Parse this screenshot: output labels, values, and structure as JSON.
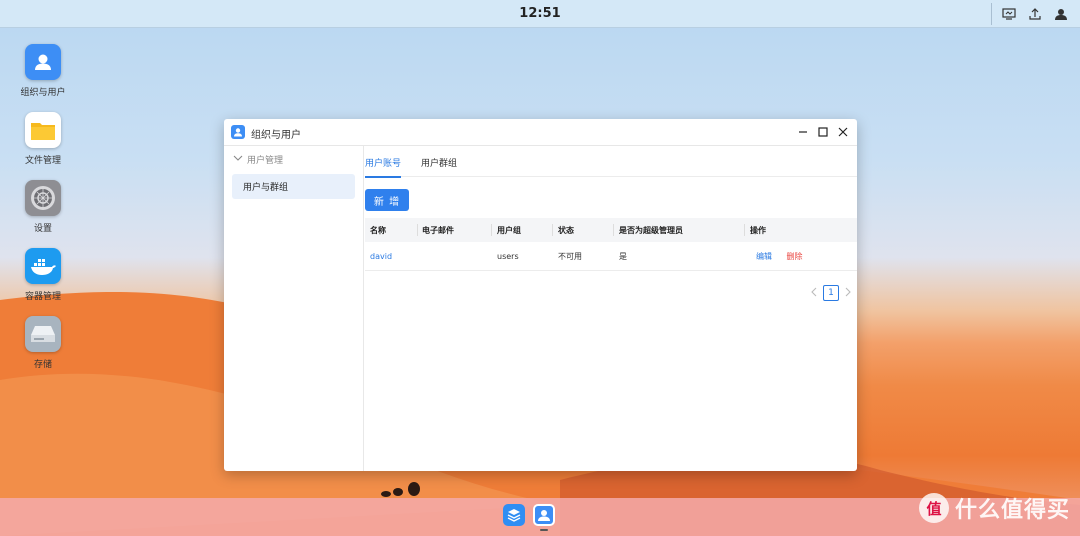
{
  "topbar": {
    "clock": "12:51",
    "tray_icons": [
      "screen-icon",
      "upload-icon",
      "user-icon"
    ]
  },
  "desktop_icons": [
    {
      "label": "组织与用户",
      "icon": "user-icon",
      "color": "#3d8ef5"
    },
    {
      "label": "文件管理",
      "icon": "folder-icon",
      "color": "#ffffff"
    },
    {
      "label": "设置",
      "icon": "settings-icon",
      "color": "#8e8e93"
    },
    {
      "label": "容器管理",
      "icon": "docker-icon",
      "color": "#1d9bf0"
    },
    {
      "label": "存储",
      "icon": "drive-icon",
      "color": "#a8b4bf"
    }
  ],
  "window": {
    "title": "组织与用户",
    "sidebar": {
      "group_label": "用户管理",
      "items": [
        {
          "label": "用户与群组"
        }
      ]
    },
    "tabs": [
      {
        "label": "用户账号"
      },
      {
        "label": "用户群组"
      }
    ],
    "add_button": "新 增",
    "table": {
      "headers": [
        "名称",
        "电子邮件",
        "用户组",
        "状态",
        "是否为超级管理员",
        "操作"
      ],
      "rows": [
        {
          "name": "david",
          "email": "",
          "group": "users",
          "status": "不可用",
          "is_admin": "是",
          "edit": "编辑",
          "delete": "删除"
        }
      ]
    },
    "pagination": {
      "current": "1"
    }
  },
  "watermark": {
    "symbol": "值",
    "text": "什么值得买"
  }
}
